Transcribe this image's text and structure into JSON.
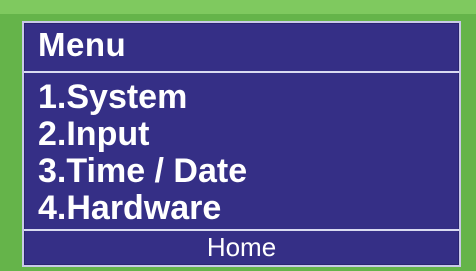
{
  "screen": {
    "title": "Menu",
    "items": [
      {
        "label": "1.System"
      },
      {
        "label": "2.Input"
      },
      {
        "label": "3.Time / Date"
      },
      {
        "label": "4.Hardware"
      }
    ],
    "footer": {
      "label": "Home"
    }
  },
  "colors": {
    "bezel": "#65b44a",
    "screen_background": "#352f86",
    "text": "#ffffff",
    "divider": "#d9dbf1"
  }
}
